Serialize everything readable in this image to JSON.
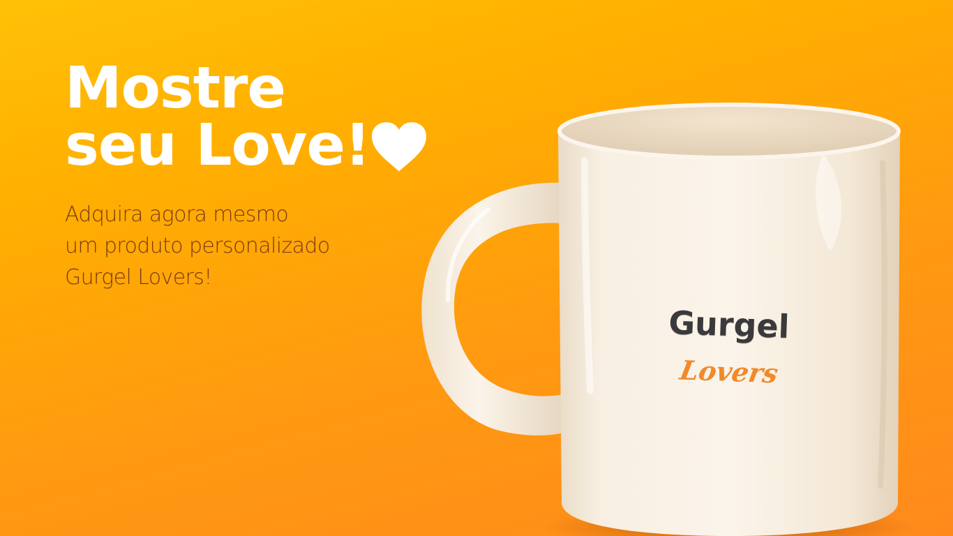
{
  "headline": {
    "line1": "Mostre",
    "line2": "seu Love!",
    "icon": "heart-icon"
  },
  "subtext": {
    "line1": "Adquira agora mesmo",
    "line2": "um produto personalizado",
    "line3": "Gurgel Lovers!"
  },
  "mug": {
    "brand": "Gurgel",
    "tagline": "Lovers"
  },
  "colors": {
    "background_top": "#ffc107",
    "background_bottom": "#ff8a1c",
    "headline": "#ffffff",
    "subtext": "#7a3a14",
    "mug_body": "#f6ead8",
    "brand_text": "#3a3a3c",
    "tagline_text": "#f08a2a"
  }
}
